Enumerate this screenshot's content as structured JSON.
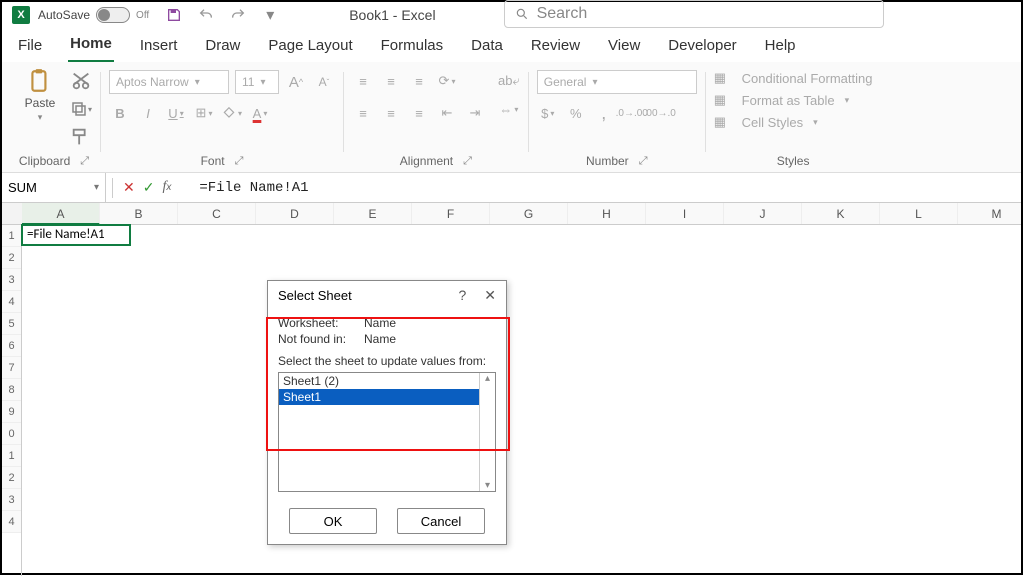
{
  "titlebar": {
    "autosave_label": "AutoSave",
    "autosave_state": "Off",
    "title": "Book1 - Excel"
  },
  "search": {
    "placeholder": "Search"
  },
  "tabs": [
    "File",
    "Home",
    "Insert",
    "Draw",
    "Page Layout",
    "Formulas",
    "Data",
    "Review",
    "View",
    "Developer",
    "Help"
  ],
  "active_tab_index": 1,
  "ribbon": {
    "clipboard": {
      "paste": "Paste",
      "label": "Clipboard"
    },
    "font": {
      "name": "Aptos Narrow",
      "size": "11",
      "bold": "B",
      "italic": "I",
      "underline": "U",
      "incfont_aria": "Increase Font",
      "decfont_aria": "Decrease Font",
      "label": "Font"
    },
    "alignment": {
      "label": "Alignment"
    },
    "number": {
      "format": "General",
      "label": "Number"
    },
    "styles": {
      "cond": "Conditional Formatting",
      "table": "Format as Table",
      "cell": "Cell Styles",
      "label": "Styles"
    }
  },
  "formula_bar": {
    "namebox": "SUM",
    "formula": "=File Name!A1"
  },
  "grid": {
    "columns": [
      "A",
      "B",
      "C",
      "D",
      "E",
      "F",
      "G",
      "H",
      "I",
      "J",
      "K",
      "L",
      "M"
    ],
    "rows": [
      "1",
      "2",
      "3",
      "4",
      "5",
      "6",
      "7",
      "8",
      "9",
      "0",
      "1",
      "2",
      "3",
      "4"
    ],
    "active_col_index": 0,
    "cell_A1": "=File Name!A1"
  },
  "dialog": {
    "title": "Select Sheet",
    "help": "?",
    "close": "✕",
    "worksheet_k": "Worksheet:",
    "worksheet_v": "Name",
    "notfound_k": "Not found in:",
    "notfound_v": "Name",
    "prompt": "Select the sheet to update values from:",
    "items": [
      "Sheet1 (2)",
      "Sheet1"
    ],
    "selected_index": 1,
    "ok": "OK",
    "cancel": "Cancel"
  }
}
